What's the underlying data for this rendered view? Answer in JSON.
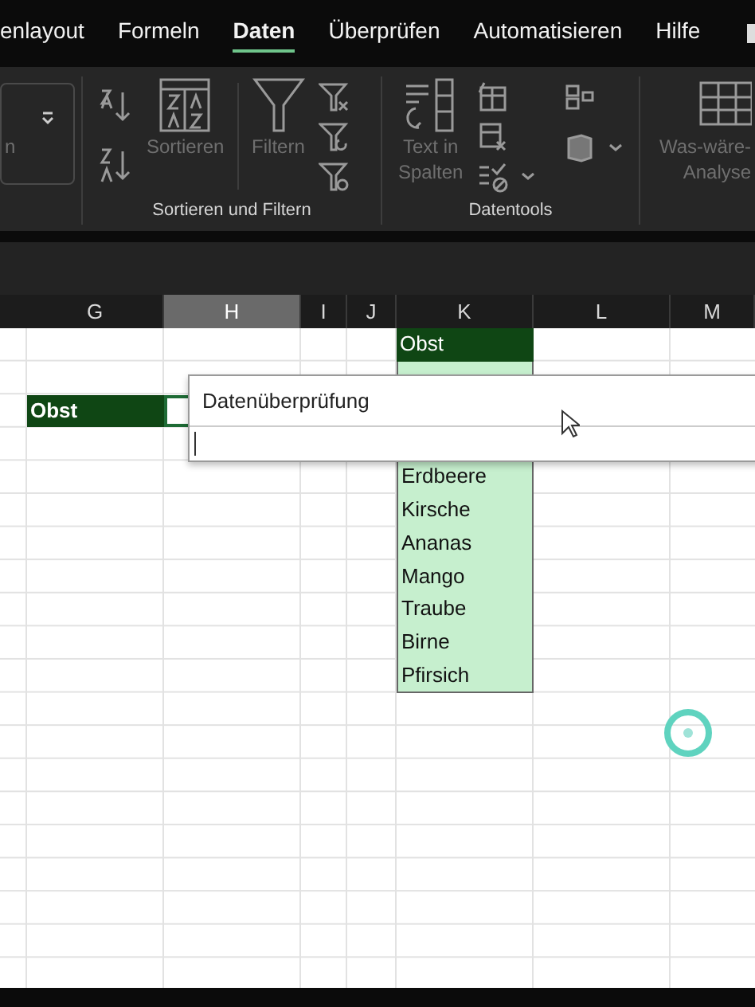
{
  "ribbon_tabs": [
    {
      "label": "enlayout",
      "selected": false
    },
    {
      "label": "Formeln",
      "selected": false
    },
    {
      "label": "Daten",
      "selected": true
    },
    {
      "label": "Überprüfen",
      "selected": false
    },
    {
      "label": "Automatisieren",
      "selected": false
    },
    {
      "label": "Hilfe",
      "selected": false
    }
  ],
  "ribbon": {
    "partial_group": {
      "text": "n"
    },
    "sort_filter_group": {
      "label": "Sortieren und Filtern",
      "sort_button": {
        "label": "Sortieren",
        "disabled": true
      },
      "filter_button": {
        "label": "Filtern",
        "disabled": true
      }
    },
    "data_tools_group": {
      "label": "Datentools",
      "text_to_columns_button": {
        "label_lines": [
          "Text in",
          "Spalten"
        ],
        "disabled": true
      }
    },
    "what_if_button": {
      "label_lines": [
        "Was-wäre-",
        "Analyse"
      ],
      "disabled": true
    }
  },
  "sheet": {
    "column_headers": [
      {
        "label": "G",
        "selected": false
      },
      {
        "label": "H",
        "selected": true
      },
      {
        "label": "I",
        "selected": false
      },
      {
        "label": "J",
        "selected": false
      },
      {
        "label": "K",
        "selected": false
      },
      {
        "label": "L",
        "selected": false
      },
      {
        "label": "M",
        "selected": false
      }
    ],
    "label_cell": {
      "text": "Obst"
    },
    "list_header": {
      "text": "Obst"
    },
    "list_items": [
      "Erdbeere",
      "Kirsche",
      "Ananas",
      "Mango",
      "Traube",
      "Birne",
      "Pfirsich"
    ],
    "validation_popup": {
      "title": "Datenüberprüfung"
    }
  }
}
